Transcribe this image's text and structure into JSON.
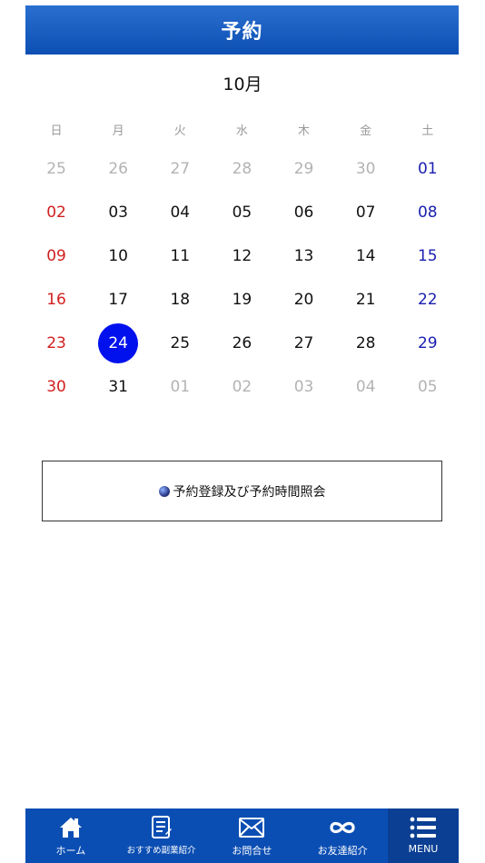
{
  "header": {
    "title": "予約"
  },
  "calendar": {
    "month_label": "10月",
    "weekdays": [
      "日",
      "月",
      "火",
      "水",
      "木",
      "金",
      "土"
    ],
    "weeks": [
      [
        {
          "label": "25",
          "type": "other"
        },
        {
          "label": "26",
          "type": "other"
        },
        {
          "label": "27",
          "type": "other"
        },
        {
          "label": "28",
          "type": "other"
        },
        {
          "label": "29",
          "type": "other"
        },
        {
          "label": "30",
          "type": "other"
        },
        {
          "label": "01",
          "type": "sat"
        }
      ],
      [
        {
          "label": "02",
          "type": "sun"
        },
        {
          "label": "03",
          "type": "normal"
        },
        {
          "label": "04",
          "type": "normal"
        },
        {
          "label": "05",
          "type": "normal"
        },
        {
          "label": "06",
          "type": "normal"
        },
        {
          "label": "07",
          "type": "normal"
        },
        {
          "label": "08",
          "type": "sat"
        }
      ],
      [
        {
          "label": "09",
          "type": "sun"
        },
        {
          "label": "10",
          "type": "normal"
        },
        {
          "label": "11",
          "type": "normal"
        },
        {
          "label": "12",
          "type": "normal"
        },
        {
          "label": "13",
          "type": "normal"
        },
        {
          "label": "14",
          "type": "normal"
        },
        {
          "label": "15",
          "type": "sat"
        }
      ],
      [
        {
          "label": "16",
          "type": "sun"
        },
        {
          "label": "17",
          "type": "normal"
        },
        {
          "label": "18",
          "type": "normal"
        },
        {
          "label": "19",
          "type": "normal"
        },
        {
          "label": "20",
          "type": "normal"
        },
        {
          "label": "21",
          "type": "normal"
        },
        {
          "label": "22",
          "type": "sat"
        }
      ],
      [
        {
          "label": "23",
          "type": "sun"
        },
        {
          "label": "24",
          "type": "selected"
        },
        {
          "label": "25",
          "type": "normal"
        },
        {
          "label": "26",
          "type": "normal"
        },
        {
          "label": "27",
          "type": "normal"
        },
        {
          "label": "28",
          "type": "normal"
        },
        {
          "label": "29",
          "type": "sat"
        }
      ],
      [
        {
          "label": "30",
          "type": "sun"
        },
        {
          "label": "31",
          "type": "normal"
        },
        {
          "label": "01",
          "type": "other"
        },
        {
          "label": "02",
          "type": "other"
        },
        {
          "label": "03",
          "type": "other"
        },
        {
          "label": "04",
          "type": "other"
        },
        {
          "label": "05",
          "type": "other"
        }
      ]
    ]
  },
  "reserve_button": {
    "label": "予約登録及び予約時間照会",
    "icon": "globe-icon"
  },
  "tabbar": {
    "items": [
      {
        "label": "ホーム",
        "icon": "home-icon"
      },
      {
        "label": "おすすめ副業紹介",
        "icon": "document-list-icon"
      },
      {
        "label": "お問合せ",
        "icon": "envelope-icon"
      },
      {
        "label": "お友達紹介",
        "icon": "infinity-icon"
      },
      {
        "label": "MENU",
        "icon": "hamburger-menu-icon"
      }
    ]
  },
  "colors": {
    "header_blue": "#0d4fb3",
    "selected_day": "#0011ee",
    "sunday_red": "#d21f1f",
    "saturday_blue": "#1a1fb0",
    "muted_gray": "#b3b3b3"
  }
}
